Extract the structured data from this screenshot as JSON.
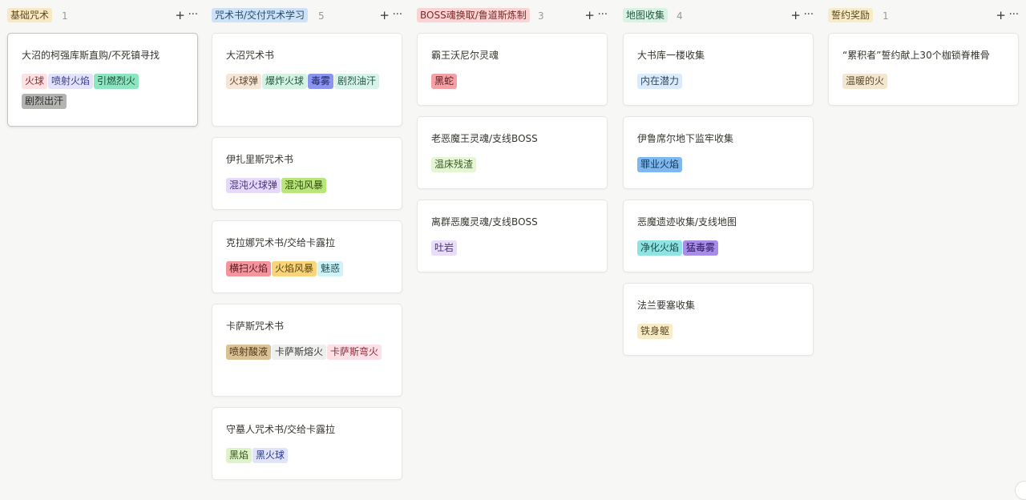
{
  "board": {
    "columns": [
      {
        "title": "基础咒术",
        "count": "1",
        "color": "#f8e8c4",
        "text_color": "#5c4a1e",
        "cards": [
          {
            "title": "大沼的柯强库斯直购/不死镇寻找",
            "tags": [
              {
                "label": "火球",
                "bg": "#fde2e4",
                "fg": "#8a2b33"
              },
              {
                "label": "喷射火焰",
                "bg": "#e3e4fb",
                "fg": "#3a3b8a"
              },
              {
                "label": "引燃烈火",
                "bg": "#8ee6c0",
                "fg": "#1c4d37"
              },
              {
                "label": "剧烈出汗",
                "bg": "#b3b3b1",
                "fg": "#2c2c2a"
              }
            ]
          }
        ]
      },
      {
        "title": "咒术书/交付咒术学习",
        "count": "5",
        "color": "#cde2f6",
        "text_color": "#274b6d",
        "cards": [
          {
            "title": "大沼咒术书",
            "tags": [
              {
                "label": "火球弹",
                "bg": "#f4e6d8",
                "fg": "#6b4a2b"
              },
              {
                "label": "爆炸火球",
                "bg": "#d5f3e3",
                "fg": "#215a3c"
              },
              {
                "label": "毒雾",
                "bg": "#8b95f0",
                "fg": "#1e2366"
              },
              {
                "label": "剧烈油汗",
                "bg": "#d8f4ea",
                "fg": "#245a46"
              }
            ]
          },
          {
            "title": "伊扎里斯咒术书",
            "tags": [
              {
                "label": "混沌火球弹",
                "bg": "#e6dafb",
                "fg": "#4c2f86"
              },
              {
                "label": "混沌风暴",
                "bg": "#b9e67b",
                "fg": "#2f4a12"
              }
            ]
          },
          {
            "title": "克拉娜咒术书/交给卡露拉",
            "tags": [
              {
                "label": "横扫火焰",
                "bg": "#f4949c",
                "fg": "#5a1a20"
              },
              {
                "label": "火焰风暴",
                "bg": "#f8d47a",
                "fg": "#5c4510"
              },
              {
                "label": "魅惑",
                "bg": "#cff3f6",
                "fg": "#1f5257"
              }
            ]
          },
          {
            "title": "卡萨斯咒术书",
            "tags": [
              {
                "label": "喷射酸液",
                "bg": "#dcc196",
                "fg": "#4e3a19"
              },
              {
                "label": "卡萨斯熔火",
                "bg": "#efefed",
                "fg": "#3a3a37"
              },
              {
                "label": "卡萨斯弯火",
                "bg": "#fde0e5",
                "fg": "#8a2b3b"
              }
            ]
          },
          {
            "title": "守墓人咒术书/交给卡露拉",
            "tags": [
              {
                "label": "黑焰",
                "bg": "#dff3c8",
                "fg": "#37541b"
              },
              {
                "label": "黑火球",
                "bg": "#dfe4fb",
                "fg": "#2c3a86"
              }
            ]
          }
        ]
      },
      {
        "title": "BOSS魂换取/鲁道斯炼制",
        "count": "3",
        "color": "#fbd3d3",
        "text_color": "#7a2c2c",
        "cards": [
          {
            "title": "霸王沃尼尔灵魂",
            "tags": [
              {
                "label": "黑蛇",
                "bg": "#f4a1a6",
                "fg": "#5a1a20"
              }
            ]
          },
          {
            "title": "老恶魔王灵魂/支线BOSS",
            "tags": [
              {
                "label": "温床残渣",
                "bg": "#e4f6d4",
                "fg": "#3b5a22"
              }
            ]
          },
          {
            "title": "离群恶魔灵魂/支线BOSS",
            "tags": [
              {
                "label": "吐岩",
                "bg": "#e9def8",
                "fg": "#4c2f86"
              }
            ]
          }
        ]
      },
      {
        "title": "地图收集",
        "count": "4",
        "color": "#d8f3e4",
        "text_color": "#245a3e",
        "cards": [
          {
            "title": "大书库一楼收集",
            "tags": [
              {
                "label": "内在潜力",
                "bg": "#dcebfa",
                "fg": "#2c4a6d"
              }
            ]
          },
          {
            "title": "伊鲁席尔地下监牢收集",
            "tags": [
              {
                "label": "罪业火焰",
                "bg": "#7fb8ee",
                "fg": "#12375a"
              }
            ]
          },
          {
            "title": "恶魔遗迹收集/支线地图",
            "tags": [
              {
                "label": "净化火焰",
                "bg": "#8fe4e3",
                "fg": "#134a49"
              },
              {
                "label": "猛毒雾",
                "bg": "#a98be8",
                "fg": "#2b1760"
              }
            ]
          },
          {
            "title": "法兰要塞收集",
            "tags": [
              {
                "label": "铁身躯",
                "bg": "#f8ecc8",
                "fg": "#5c4a1e"
              }
            ]
          }
        ]
      },
      {
        "title": "誓约奖励",
        "count": "1",
        "color": "#f8ecc8",
        "text_color": "#5c4a1e",
        "cards": [
          {
            "title": "“累积者”誓约献上30个枷锁脊椎骨",
            "tags": [
              {
                "label": "温暖的火",
                "bg": "#f3e7d2",
                "fg": "#5c4a2b"
              }
            ]
          }
        ]
      }
    ]
  },
  "icons": {
    "add": "+",
    "more": "···"
  }
}
